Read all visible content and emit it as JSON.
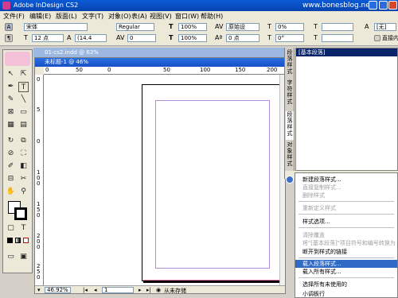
{
  "window": {
    "title": "Adobe InDesign CS2",
    "watermark": "www.bonesblog.net"
  },
  "menus": [
    "文件(F)",
    "编辑(E)",
    "版面(L)",
    "文字(T)",
    "对象(O)",
    "表(A)",
    "视图(V)",
    "窗口(W)",
    "帮助(H)"
  ],
  "control": {
    "font_family": "宋体",
    "font_style": "Regular",
    "font_size": "12 点",
    "leading": "(14.4",
    "vscale": "100%",
    "hscale": "100%",
    "kerning": "原始设",
    "tracking": "0",
    "baseline": "0 点",
    "skew": "0°",
    "skew2": "0%",
    "char_style": "[无]",
    "direct_insert": "直接内"
  },
  "document": {
    "back_title": "01-cs2.indd @ 63%",
    "title": "未标题-1 @ 46%",
    "ruler_top": [
      "0",
      "50",
      "0",
      "50",
      "100",
      "150",
      "200"
    ],
    "ruler_left": [
      "0",
      "5",
      "0",
      "1 0 0",
      "1 5 0",
      "2 0 0",
      "2 5 0"
    ],
    "zoom": "46.92%",
    "page_number": "1",
    "status": "从未存储"
  },
  "panel": {
    "tabs": [
      "段落样式",
      "字符样式",
      "段落样式",
      "对象样式"
    ],
    "selected_item": "[基本段落]"
  },
  "flyout": {
    "items": [
      {
        "label": "新建段落样式...",
        "enabled": true,
        "highlighted": false
      },
      {
        "label": "直接复制样式...",
        "enabled": false,
        "highlighted": false
      },
      {
        "label": "删除样式",
        "enabled": false,
        "highlighted": false
      },
      {
        "label": "重新定义样式",
        "enabled": false,
        "highlighted": false
      },
      {
        "label": "样式选项...",
        "enabled": true,
        "highlighted": false
      },
      {
        "label": "清除覆盖",
        "enabled": false,
        "highlighted": false
      },
      {
        "label": "将\"[基本段落]\"项目符号和编号转换为",
        "enabled": false,
        "highlighted": false
      },
      {
        "label": "断开到样式的链接",
        "enabled": true,
        "highlighted": false
      },
      {
        "label": "载入段落样式...",
        "enabled": true,
        "highlighted": true
      },
      {
        "label": "载入所有样式...",
        "enabled": true,
        "highlighted": false
      },
      {
        "label": "选择所有未使用的",
        "enabled": true,
        "highlighted": false
      },
      {
        "label": "小调板行",
        "enabled": true,
        "highlighted": false
      }
    ]
  },
  "colors": {
    "highlight": "#316ac5",
    "titlebar": "#0843b0",
    "bleed": "#e07aa8",
    "margin": "#b58ad8"
  }
}
